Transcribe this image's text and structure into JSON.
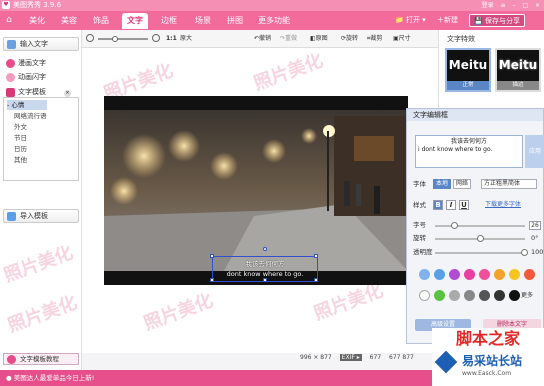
{
  "app": {
    "title": "美图秀秀 3.9.6",
    "login": "登录",
    "logo_glyph": "♥"
  },
  "tabs": [
    "美化",
    "美容",
    "饰品",
    "文字",
    "边框",
    "场景",
    "拼图",
    "更多功能"
  ],
  "active_tab": "文字",
  "top_actions": {
    "open": "打开",
    "new": "新建",
    "save_share": "保存与分享"
  },
  "toolbar": {
    "zoom_value": "1:1",
    "original": "原大",
    "undo": "撤销",
    "redo": "重做",
    "compare": "原图",
    "rotate": "旋转",
    "crop": "裁剪",
    "size": "尺寸"
  },
  "left_panel": {
    "input_text": "输入文字",
    "comic_text": "漫画文字",
    "animated_text": "动画闪字",
    "template_header": "文字模板",
    "templates": [
      "心情",
      "网络流行语",
      "节日",
      "外文",
      "节日",
      "日历",
      "其他"
    ],
    "selected_template": "心情",
    "import_template": "导入模板",
    "template_tutorial": "文字模板教程"
  },
  "watermark_text": "照片美化",
  "photo_caption": {
    "line1": "我该去何何方",
    "line2": "dont know where to go."
  },
  "status": {
    "dimensions": "996 × 877",
    "exif": "EXIF ▸",
    "size2": "677",
    "size3": "677 877"
  },
  "right_panel": {
    "section_title": "文字特效",
    "effects": [
      {
        "big": "Meitu",
        "label": "正常"
      },
      {
        "big": "Meitu",
        "label": "描边"
      }
    ]
  },
  "dialog": {
    "title": "文字编辑框",
    "text_line1": "我该去何何方",
    "text_line2": "i dont know where to go.",
    "apply": "应用",
    "font_label": "字体",
    "font_tabs": [
      "本地",
      "网络"
    ],
    "font_name": "方正粗黑简体",
    "style_label": "样式",
    "style_buttons": [
      "B",
      "I",
      "U"
    ],
    "download_fonts": "下载更多字体",
    "size_label": "字号",
    "size_value": "26",
    "rotate_label": "旋转",
    "rotate_value": "0°",
    "opacity_label": "透明度",
    "opacity_value": "100",
    "more_label": "更多",
    "advanced": "高级设置",
    "delete": "删除本文字"
  },
  "bottom": {
    "ticker": "美图达人最爱单品今日上新!",
    "brand_title": "脚本之家",
    "brand_name": "易采站长站",
    "brand_url": "www.Easck.Com"
  },
  "colors": {
    "brand_pink": "#f26b9a",
    "swatches_row1": [
      "#7fb3f0",
      "#5aa0e8",
      "#b34ad6",
      "#e83fa0",
      "#f0509a",
      "#f3a12a",
      "#f7c51e",
      "#f35a3c"
    ],
    "swatches_row2": [
      "#ffffff",
      "#5ac241",
      "#aaaaaa",
      "#888888",
      "#555555",
      "#333333",
      "#111111"
    ]
  }
}
